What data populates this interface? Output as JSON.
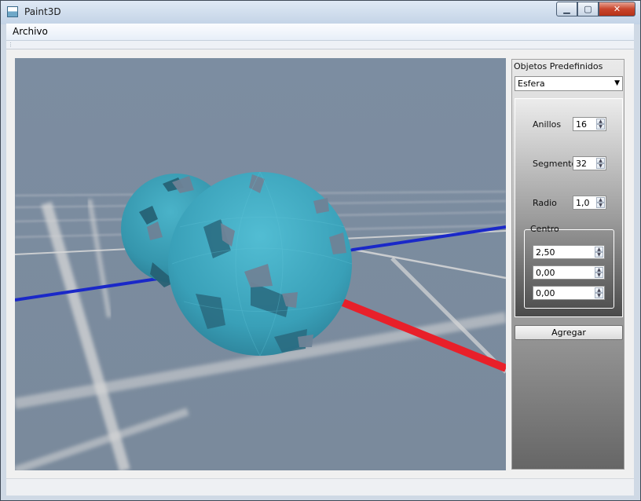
{
  "window": {
    "title": "Paint3D",
    "min_symbol": "▁",
    "max_symbol": "▢",
    "close_symbol": "✕"
  },
  "menu": {
    "items": [
      "Archivo"
    ]
  },
  "panel": {
    "title": "Objetos Predefinidos",
    "object_type": "Esfera",
    "params": [
      {
        "label": "Anillos",
        "value": "16"
      },
      {
        "label": "Segmento",
        "value": "32"
      },
      {
        "label": "Radio",
        "value": "1,0"
      }
    ],
    "centro": {
      "title": "Centro",
      "values": [
        "2,50",
        "0,00",
        "0,00"
      ]
    },
    "add_label": "Agregar"
  },
  "scene": {
    "background": "#7a8b9f",
    "axis_colors": {
      "x": "#e8202a",
      "z": "#1020d0",
      "grid": "#d8d8d8"
    },
    "sphere_color": "#3a9fb6"
  }
}
